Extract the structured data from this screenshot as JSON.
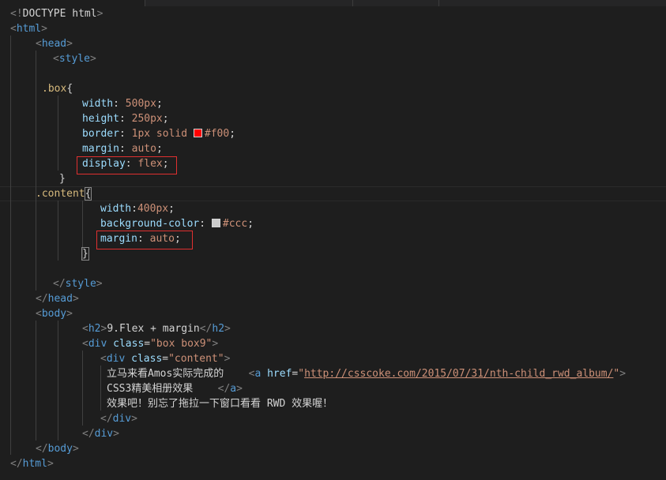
{
  "editor": {
    "lines": [
      [
        {
          "t": "<!",
          "c": "punc"
        },
        {
          "t": "DOCTYPE html",
          "c": "txt"
        },
        {
          "t": ">",
          "c": "punc"
        }
      ],
      [
        {
          "t": "<",
          "c": "punc"
        },
        {
          "t": "html",
          "c": "tag"
        },
        {
          "t": ">",
          "c": "punc"
        }
      ],
      [
        {
          "t": "<",
          "c": "punc"
        },
        {
          "t": "head",
          "c": "tag"
        },
        {
          "t": ">",
          "c": "punc"
        }
      ],
      [
        {
          "t": "<",
          "c": "punc"
        },
        {
          "t": "style",
          "c": "tag"
        },
        {
          "t": ">",
          "c": "punc"
        }
      ],
      [],
      [
        {
          "t": ".box",
          "c": "sel"
        },
        {
          "t": "{",
          "c": "brace"
        }
      ],
      [
        {
          "t": "width",
          "c": "prop"
        },
        {
          "t": ": ",
          "c": "txt"
        },
        {
          "t": "500px",
          "c": "val"
        },
        {
          "t": ";",
          "c": "txt"
        }
      ],
      [
        {
          "t": "height",
          "c": "prop"
        },
        {
          "t": ": ",
          "c": "txt"
        },
        {
          "t": "250px",
          "c": "val"
        },
        {
          "t": ";",
          "c": "txt"
        }
      ],
      [
        {
          "t": "border",
          "c": "prop"
        },
        {
          "t": ": ",
          "c": "txt"
        },
        {
          "t": "1px solid ",
          "c": "val"
        },
        {
          "swatch": "#ff0000"
        },
        {
          "t": "#f00",
          "c": "val"
        },
        {
          "t": ";",
          "c": "txt"
        }
      ],
      [
        {
          "t": "margin",
          "c": "prop"
        },
        {
          "t": ": ",
          "c": "txt"
        },
        {
          "t": "auto",
          "c": "val"
        },
        {
          "t": ";",
          "c": "txt"
        }
      ],
      [
        {
          "t": "display",
          "c": "prop"
        },
        {
          "t": ": ",
          "c": "txt"
        },
        {
          "t": "flex",
          "c": "val"
        },
        {
          "t": ";",
          "c": "txt"
        }
      ],
      [
        {
          "t": "}",
          "c": "brace"
        }
      ],
      [
        {
          "t": ".content",
          "c": "sel"
        },
        {
          "t": "{",
          "c": "brace",
          "hl": true
        }
      ],
      [
        {
          "t": "width",
          "c": "prop"
        },
        {
          "t": ":",
          "c": "txt"
        },
        {
          "t": "400px",
          "c": "val"
        },
        {
          "t": ";",
          "c": "txt"
        }
      ],
      [
        {
          "t": "background-color",
          "c": "prop"
        },
        {
          "t": ": ",
          "c": "txt"
        },
        {
          "swatch": "#cccccc"
        },
        {
          "t": "#ccc",
          "c": "val"
        },
        {
          "t": ";",
          "c": "txt"
        }
      ],
      [
        {
          "t": "margin",
          "c": "prop"
        },
        {
          "t": ": ",
          "c": "txt"
        },
        {
          "t": "auto",
          "c": "val"
        },
        {
          "t": ";",
          "c": "txt"
        }
      ],
      [
        {
          "t": "}",
          "c": "brace",
          "hl": true
        }
      ],
      [],
      [
        {
          "t": "</",
          "c": "punc"
        },
        {
          "t": "style",
          "c": "tag"
        },
        {
          "t": ">",
          "c": "punc"
        }
      ],
      [
        {
          "t": "</",
          "c": "punc"
        },
        {
          "t": "head",
          "c": "tag"
        },
        {
          "t": ">",
          "c": "punc"
        }
      ],
      [
        {
          "t": "<",
          "c": "punc"
        },
        {
          "t": "body",
          "c": "tag"
        },
        {
          "t": ">",
          "c": "punc"
        }
      ],
      [
        {
          "t": "<",
          "c": "punc"
        },
        {
          "t": "h2",
          "c": "tag"
        },
        {
          "t": ">",
          "c": "punc"
        },
        {
          "t": "9.Flex + margin",
          "c": "txt"
        },
        {
          "t": "</",
          "c": "punc"
        },
        {
          "t": "h2",
          "c": "tag"
        },
        {
          "t": ">",
          "c": "punc"
        }
      ],
      [
        {
          "t": "<",
          "c": "punc"
        },
        {
          "t": "div",
          "c": "tag"
        },
        {
          "t": " ",
          "c": "txt"
        },
        {
          "t": "class",
          "c": "attr"
        },
        {
          "t": "=",
          "c": "txt"
        },
        {
          "t": "\"box box9\"",
          "c": "str"
        },
        {
          "t": ">",
          "c": "punc"
        }
      ],
      [
        {
          "t": "<",
          "c": "punc"
        },
        {
          "t": "div",
          "c": "tag"
        },
        {
          "t": " ",
          "c": "txt"
        },
        {
          "t": "class",
          "c": "attr"
        },
        {
          "t": "=",
          "c": "txt"
        },
        {
          "t": "\"content\"",
          "c": "str"
        },
        {
          "t": ">",
          "c": "punc"
        }
      ],
      [
        {
          "t": "立马来看Amos实际完成的    ",
          "c": "txt"
        },
        {
          "t": "<",
          "c": "punc"
        },
        {
          "t": "a",
          "c": "tag"
        },
        {
          "t": " ",
          "c": "txt"
        },
        {
          "t": "href",
          "c": "attr"
        },
        {
          "t": "=",
          "c": "txt"
        },
        {
          "t": "\"",
          "c": "str"
        },
        {
          "t": "http://csscoke.com/2015/07/31/nth-child_rwd_album/",
          "c": "url"
        },
        {
          "t": "\"",
          "c": "str"
        },
        {
          "t": ">",
          "c": "punc"
        }
      ],
      [
        {
          "t": "CSS3精美相册效果    ",
          "c": "txt"
        },
        {
          "t": "</",
          "c": "punc"
        },
        {
          "t": "a",
          "c": "tag"
        },
        {
          "t": ">",
          "c": "punc"
        }
      ],
      [
        {
          "t": "效果吧！别忘了拖拉一下窗口看看 RWD 效果喔！",
          "c": "txt"
        }
      ],
      [
        {
          "t": "</",
          "c": "punc"
        },
        {
          "t": "div",
          "c": "tag"
        },
        {
          "t": ">",
          "c": "punc"
        }
      ],
      [
        {
          "t": "</",
          "c": "punc"
        },
        {
          "t": "div",
          "c": "tag"
        },
        {
          "t": ">",
          "c": "punc"
        }
      ],
      [
        {
          "t": "</",
          "c": "punc"
        },
        {
          "t": "body",
          "c": "tag"
        },
        {
          "t": ">",
          "c": "punc"
        }
      ],
      [
        {
          "t": "</",
          "c": "punc"
        },
        {
          "t": "html",
          "c": "tag"
        },
        {
          "t": ">",
          "c": "punc"
        }
      ]
    ]
  }
}
